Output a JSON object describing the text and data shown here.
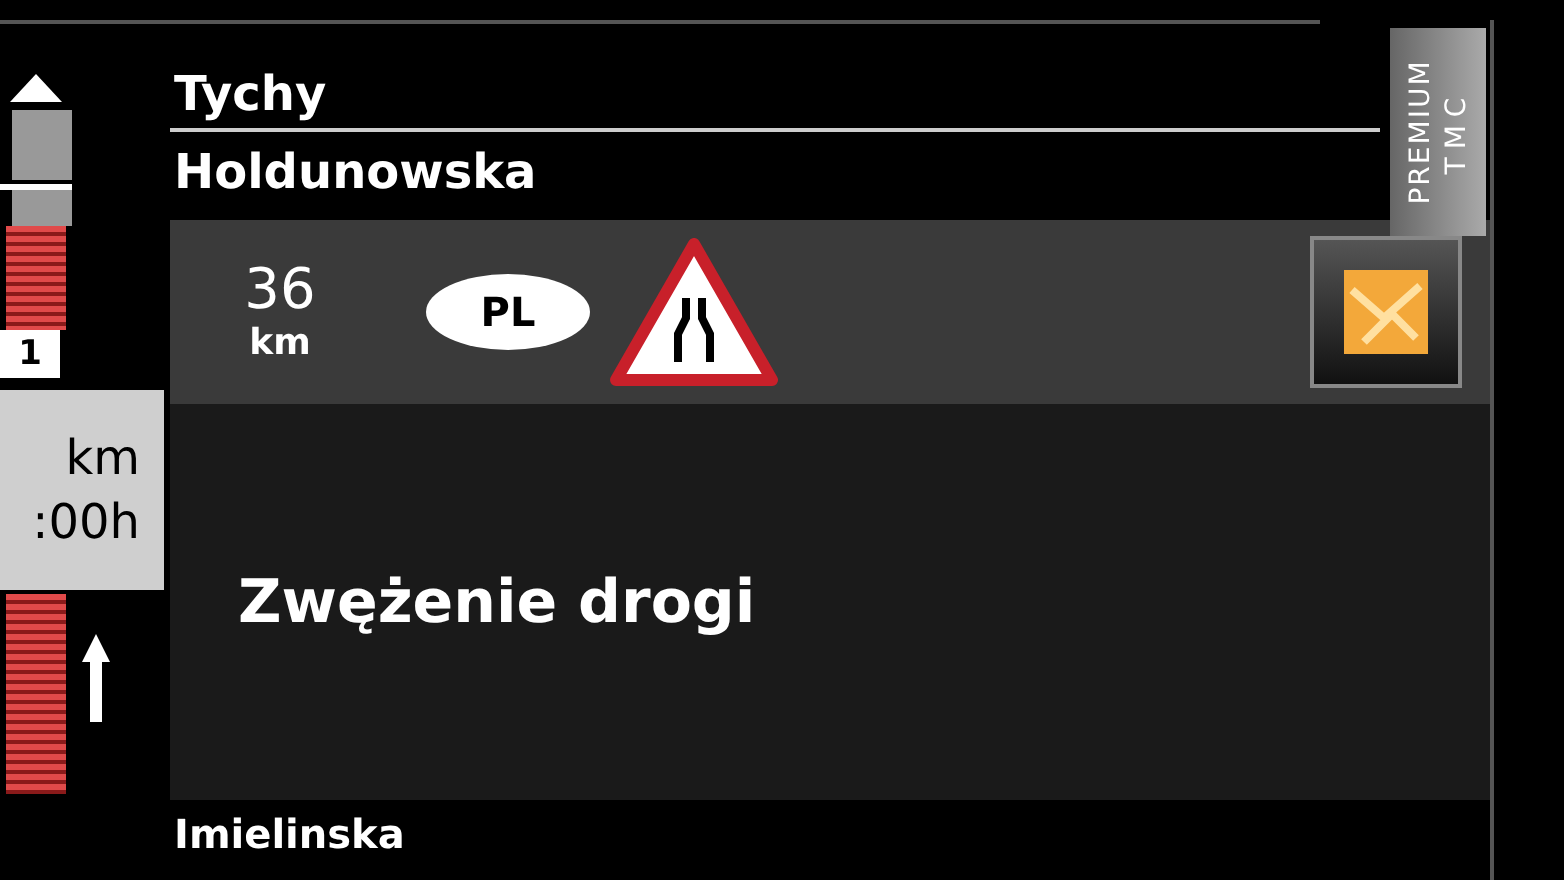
{
  "scale": {
    "marker": "1",
    "unit": "km",
    "time": ":00h"
  },
  "badge": {
    "line_1": "PREMIUM",
    "line_2": "TMC"
  },
  "streets": [
    "Tychy",
    "Holdunowska"
  ],
  "incident": {
    "distance": "36",
    "unit": "km",
    "country": "PL",
    "description": "Zwężenie drogi"
  },
  "next_street": "Imielinska"
}
